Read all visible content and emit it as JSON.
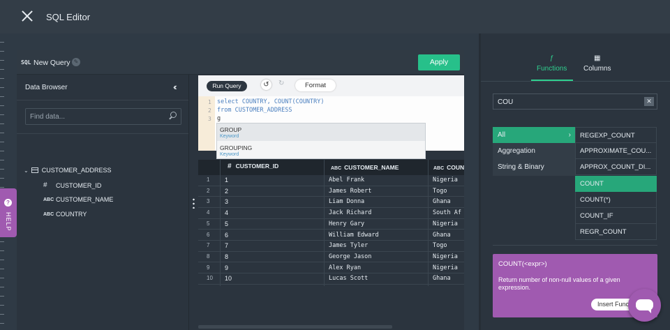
{
  "app": {
    "title": "SQL Editor"
  },
  "query": {
    "badge": "SQL",
    "name": "New Query",
    "apply_label": "Apply"
  },
  "browser": {
    "title": "Data Browser",
    "search_placeholder": "Find data...",
    "table": "CUSTOMER_ADDRESS",
    "columns": [
      {
        "type": "#",
        "name": "CUSTOMER_ID"
      },
      {
        "type": "ABC",
        "name": "CUSTOMER_NAME"
      },
      {
        "type": "ABC",
        "name": "COUNTRY"
      }
    ]
  },
  "toolbar": {
    "run_label": "Run Query",
    "format_label": "Format"
  },
  "code": {
    "lines": [
      "select COUNTRY, COUNT(COUNTRY)",
      "from CUSTOMER_ADDRESS",
      "g"
    ],
    "line_numbers": [
      "1",
      "2",
      "3"
    ]
  },
  "autocomplete": [
    {
      "name": "GROUP",
      "kind": "Keyword"
    },
    {
      "name": "GROUPING",
      "kind": "Keyword"
    }
  ],
  "grid": {
    "headers": [
      {
        "type": "#",
        "name": "CUSTOMER_ID"
      },
      {
        "type": "ABC",
        "name": "CUSTOMER_NAME"
      },
      {
        "type": "ABC",
        "name": "COUN"
      }
    ],
    "rows": [
      [
        "1",
        "1",
        "Abel Frank",
        "Nigeria"
      ],
      [
        "2",
        "2",
        "James Robert",
        "Togo"
      ],
      [
        "3",
        "3",
        "Liam Donna",
        "Ghana"
      ],
      [
        "4",
        "4",
        "Jack Richard",
        "South Af"
      ],
      [
        "5",
        "5",
        "Henry Gary",
        "Nigeria"
      ],
      [
        "6",
        "6",
        "William Edward",
        "Ghana"
      ],
      [
        "7",
        "7",
        "James Tyler",
        "Togo"
      ],
      [
        "8",
        "8",
        "George Jason",
        "Nigeria"
      ],
      [
        "9",
        "9",
        "Alex Ryan",
        "Nigeria"
      ],
      [
        "10",
        "10",
        "Lucas Scott",
        "Ghana"
      ]
    ]
  },
  "help": {
    "label": "HELP",
    "q": "?"
  },
  "functions_panel": {
    "tabs": [
      {
        "label": "Functions",
        "icon": "ƒ"
      },
      {
        "label": "Columns",
        "icon": "▦"
      }
    ],
    "search_value": "COU",
    "categories": [
      "All",
      "Aggregation",
      "String & Binary"
    ],
    "functions": [
      "REGEXP_COUNT",
      "APPROXIMATE_COU...",
      "APPROX_COUNT_DI...",
      "COUNT",
      "COUNT(*)",
      "COUNT_IF",
      "REGR_COUNT"
    ],
    "selected_function": "COUNT",
    "description": {
      "signature": "COUNT(<expr>)",
      "text": "Return number of non-null values of a given expression.",
      "insert_label": "Insert Func"
    }
  },
  "colors": {
    "accent": "#27c08a",
    "purple": "#a05ab0",
    "background": "#2f3a45"
  }
}
